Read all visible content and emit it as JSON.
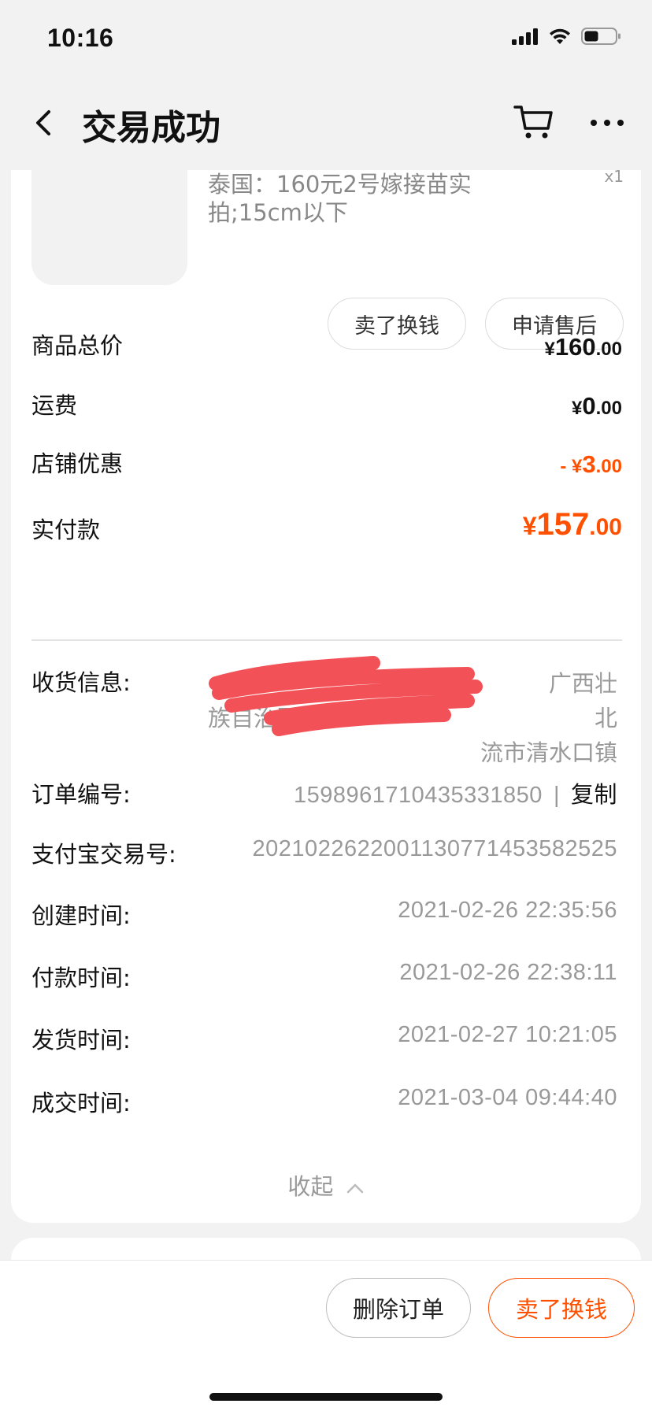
{
  "status_bar": {
    "time": "10:16"
  },
  "nav": {
    "title": "交易成功"
  },
  "item": {
    "description": "泰国：160元2号嫁接苗实拍;15cm以下",
    "quantity": "x1"
  },
  "item_actions": {
    "sell": "卖了换钱",
    "after_sale": "申请售后"
  },
  "price_rows": [
    {
      "label": "商品总价",
      "prefix": "",
      "currency": "¥",
      "int": "160",
      "dec": ".00"
    },
    {
      "label": "运费",
      "prefix": "",
      "currency": "¥",
      "int": "0",
      "dec": ".00"
    },
    {
      "label": "店铺优惠",
      "prefix": "- ",
      "currency": "¥",
      "int": "3",
      "dec": ".00"
    },
    {
      "label": "实付款",
      "prefix": "",
      "currency": "¥",
      "int": "157",
      "dec": ".00"
    }
  ],
  "shipping": {
    "label": "收货信息:",
    "line1": "广西壮",
    "line2_left": "族自治区",
    "line2_right": "北",
    "line3": "流市清水口镇"
  },
  "order": {
    "order_no_label": "订单编号:",
    "order_no": "1598961710435331850",
    "separator": "|",
    "copy": "复制",
    "alipay_label": "支付宝交易号:",
    "alipay_no": "2021022622001130771453582525",
    "created_label": "创建时间:",
    "created": "2021-02-26 22:35:56",
    "paid_label": "付款时间:",
    "paid": "2021-02-26 22:38:11",
    "shipped_label": "发货时间:",
    "shipped": "2021-02-27 10:21:05",
    "completed_label": "成交时间:",
    "completed": "2021-03-04 09:44:40"
  },
  "collapse": {
    "label": "收起"
  },
  "bottom_actions": {
    "delete": "删除订单",
    "sell": "卖了换钱"
  },
  "colors": {
    "accent": "#ff5000",
    "redaction": "#f25257"
  }
}
